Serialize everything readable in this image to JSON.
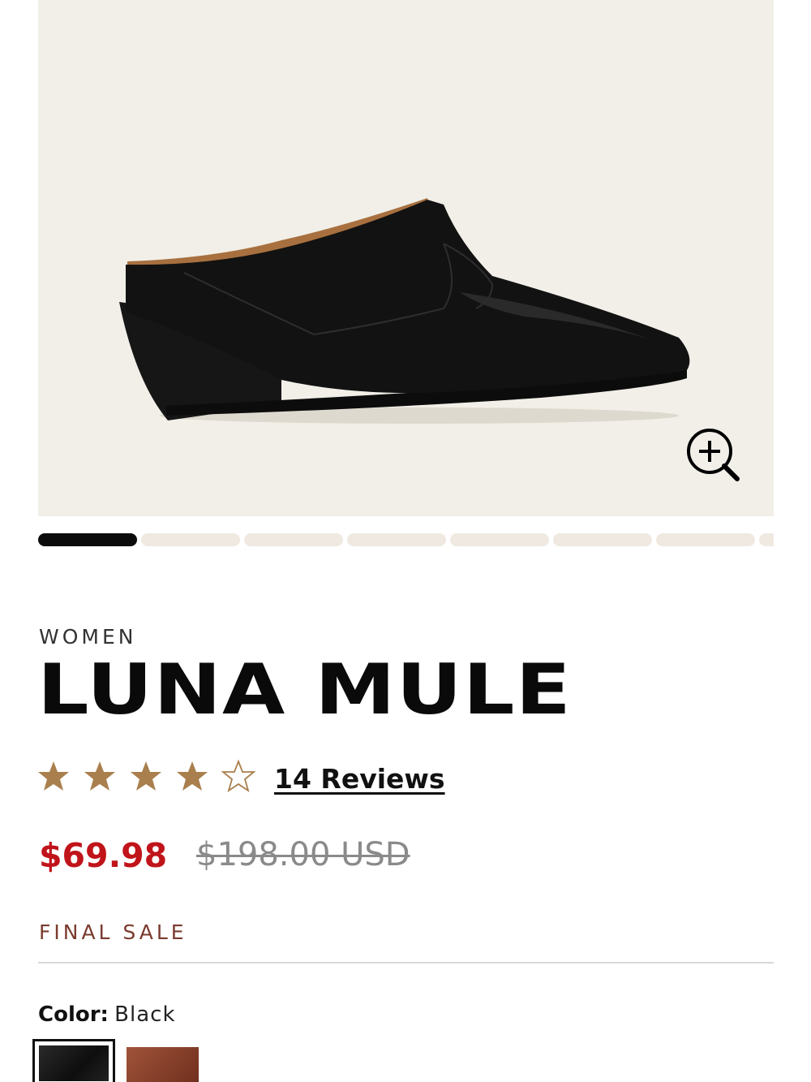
{
  "gallery": {
    "image_alt": "Luna Mule black leather western mule, side view",
    "zoom_icon": "zoom-in-icon",
    "slide_count": 8,
    "active_slide": 1
  },
  "product": {
    "category": "WOMEN",
    "title": "LUNA MULE",
    "rating": 4,
    "rating_max": 5,
    "reviews_label": "14 Reviews",
    "sale_price": "$69.98",
    "original_price": "$198.00 USD",
    "final_sale": "FINAL SALE"
  },
  "color": {
    "label": "Color:",
    "value": "Black",
    "swatches": [
      "Black",
      "Brown"
    ]
  },
  "colors": {
    "star_filled": "#a97f4d",
    "sale_price": "#c0141a",
    "final_sale": "#7a3b2e",
    "gallery_bg": "#f1efe8"
  }
}
